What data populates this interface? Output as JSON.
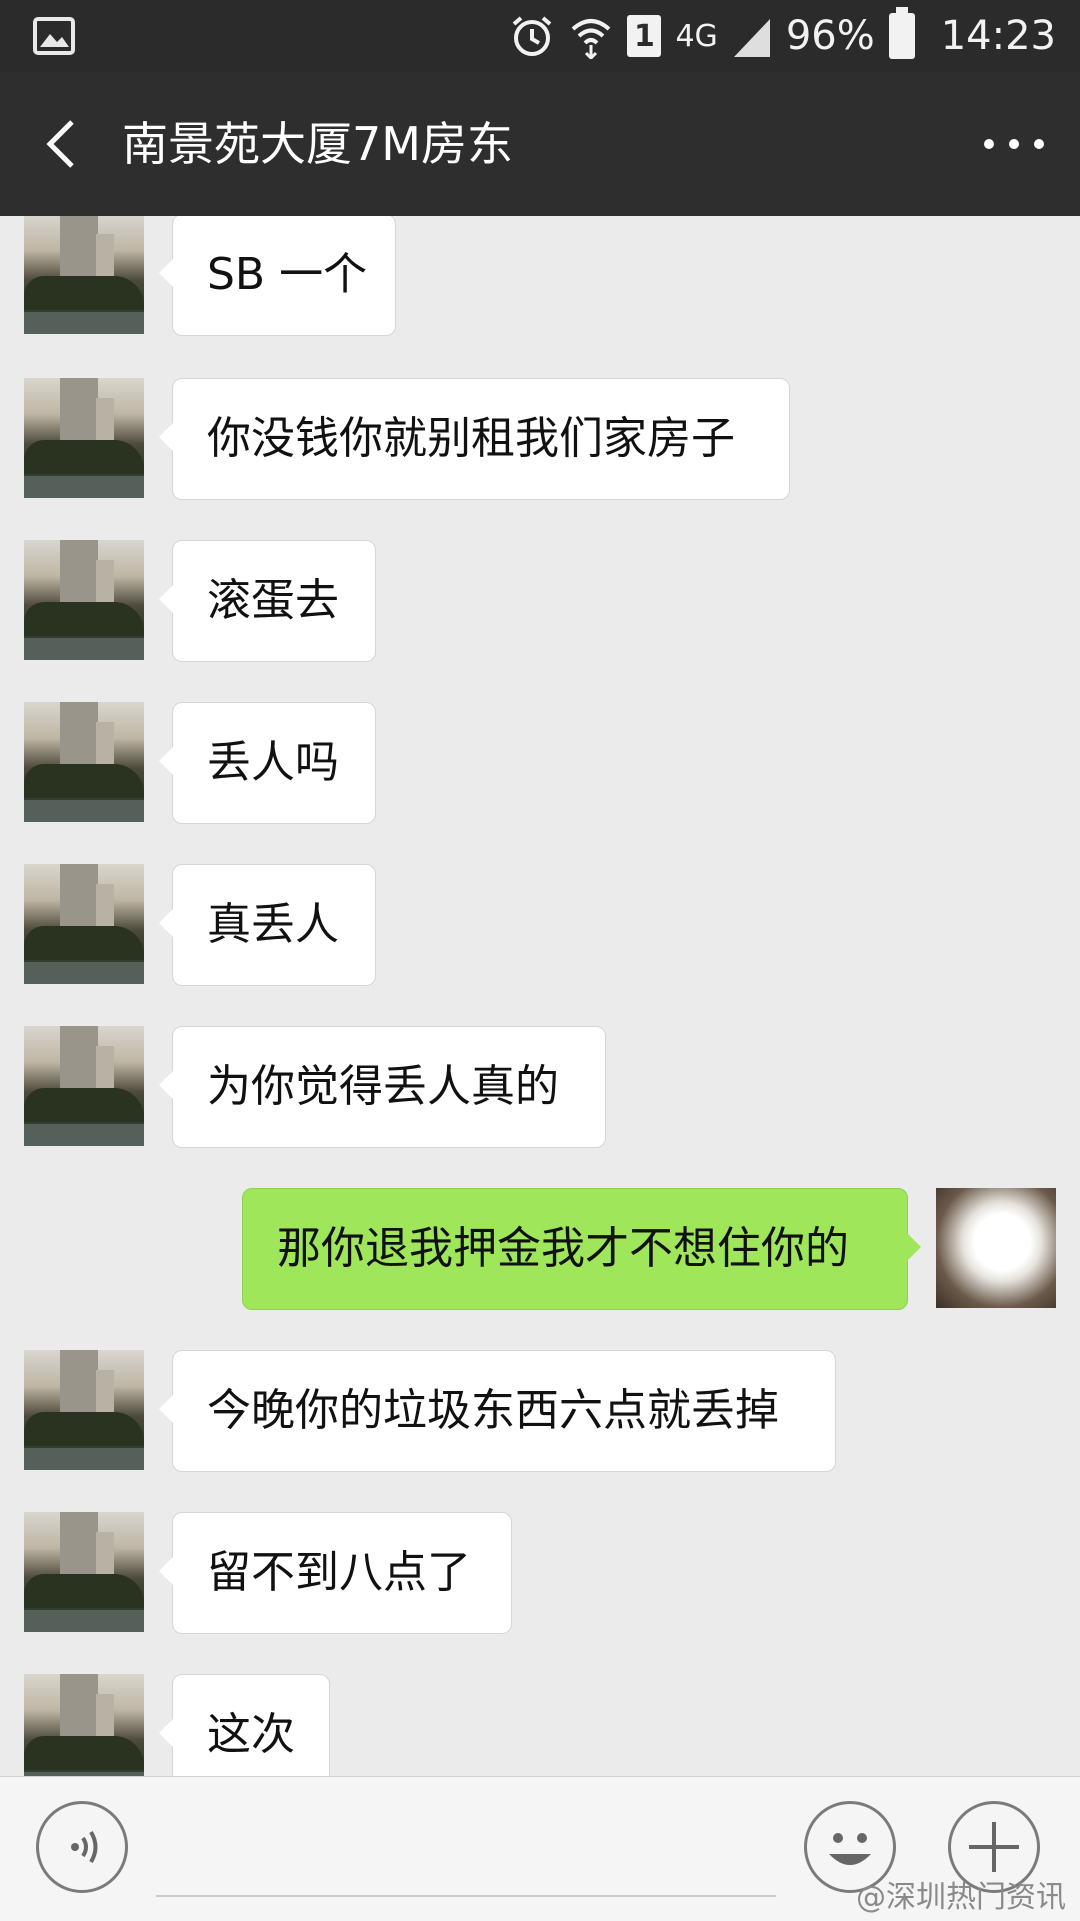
{
  "status_bar": {
    "battery": "96%",
    "time": "14:23",
    "network": "4G",
    "sim": "1"
  },
  "header": {
    "title": "南景苑大厦7M房东"
  },
  "messages": [
    {
      "side": "in",
      "text": "SB 一个"
    },
    {
      "side": "in",
      "text": "你没钱你就别租我们家房子"
    },
    {
      "side": "in",
      "text": "滚蛋去"
    },
    {
      "side": "in",
      "text": "丢人吗"
    },
    {
      "side": "in",
      "text": "真丢人"
    },
    {
      "side": "in",
      "text": "为你觉得丢人真的"
    },
    {
      "side": "out",
      "text": "那你退我押金我才不想住你的"
    },
    {
      "side": "in",
      "text": "今晚你的垃圾东西六点就丢掉"
    },
    {
      "side": "in",
      "text": "留不到八点了"
    },
    {
      "side": "in",
      "text": "这次"
    }
  ],
  "watermark": "@深圳热门资讯",
  "icons": {
    "gallery": "image-icon",
    "alarm": "alarm-icon",
    "wifi": "wifi-icon",
    "signal": "signal-icon",
    "battery": "battery-icon",
    "back": "chevron-left-icon",
    "more": "more-dots-icon",
    "voice": "voice-icon",
    "emoji": "emoji-icon",
    "plus": "plus-icon"
  }
}
